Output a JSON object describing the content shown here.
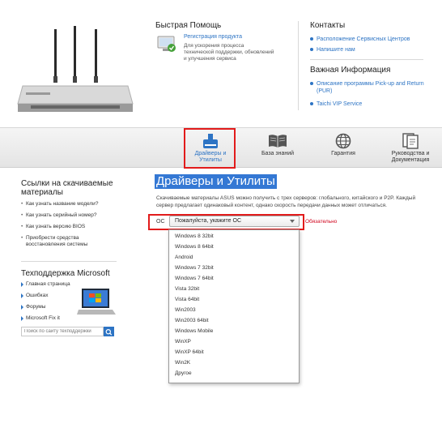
{
  "quick_help": {
    "title": "Быстрая Помощь",
    "link": "Регистрация продукта",
    "desc": "Для ускорения процесса технической поддержки, обновлений и улучшения сервиса"
  },
  "contacts": {
    "title": "Контакты",
    "items": [
      "Расположение Сервисных Центров",
      "Напишите нам"
    ]
  },
  "important": {
    "title": "Важная Информация",
    "items": [
      "Описание программы Pick-up and Return (PUR)",
      "Taichi VIP Service"
    ]
  },
  "nav": {
    "items": [
      "Драйверы и Утилиты",
      "База знаний",
      "Гарантия",
      "Руководства и Документация"
    ]
  },
  "sidebar": {
    "downloads_title": "Ссылки на скачиваемые материалы",
    "download_links": [
      "Как узнать название модели?",
      "Как узнать серийный номер?",
      "Как узнать версию BIOS",
      "Приобрести средства восстановления системы"
    ],
    "ms_title": "Техподдержка Microsoft",
    "ms_links": [
      "Главная страница",
      "Ошибках",
      "Форумы",
      "Microsoft Fix it"
    ],
    "ms_search_placeholder": "Поиск по сайту техподдержки"
  },
  "main": {
    "title": "Драйверы и Утилиты",
    "intro": "Скачиваемые материалы ASUS можно получить с трех серверов: глобального, китайского и P2P. Каждый сервер предлагает одинаковый контент, однако скорость передачи данных может отличаться.",
    "os_label": "ОС",
    "os_select_value": "Пожалуйста, укажите ОС",
    "required": "Обязательно",
    "os_options": [
      "Windows 8 32bit",
      "Windows 8 64bit",
      "Android",
      "Windows 7 32bit",
      "Windows 7 64bit",
      "Vista 32bit",
      "Vista 64bit",
      "Win2003",
      "Win2003 64bit",
      "Windows Mobile",
      "WinXP",
      "WinXP 64bit",
      "Win2K",
      "Другое"
    ]
  },
  "colors": {
    "link": "#2d74c4",
    "highlight": "#e21b1b",
    "title_bg": "#3478d4"
  }
}
